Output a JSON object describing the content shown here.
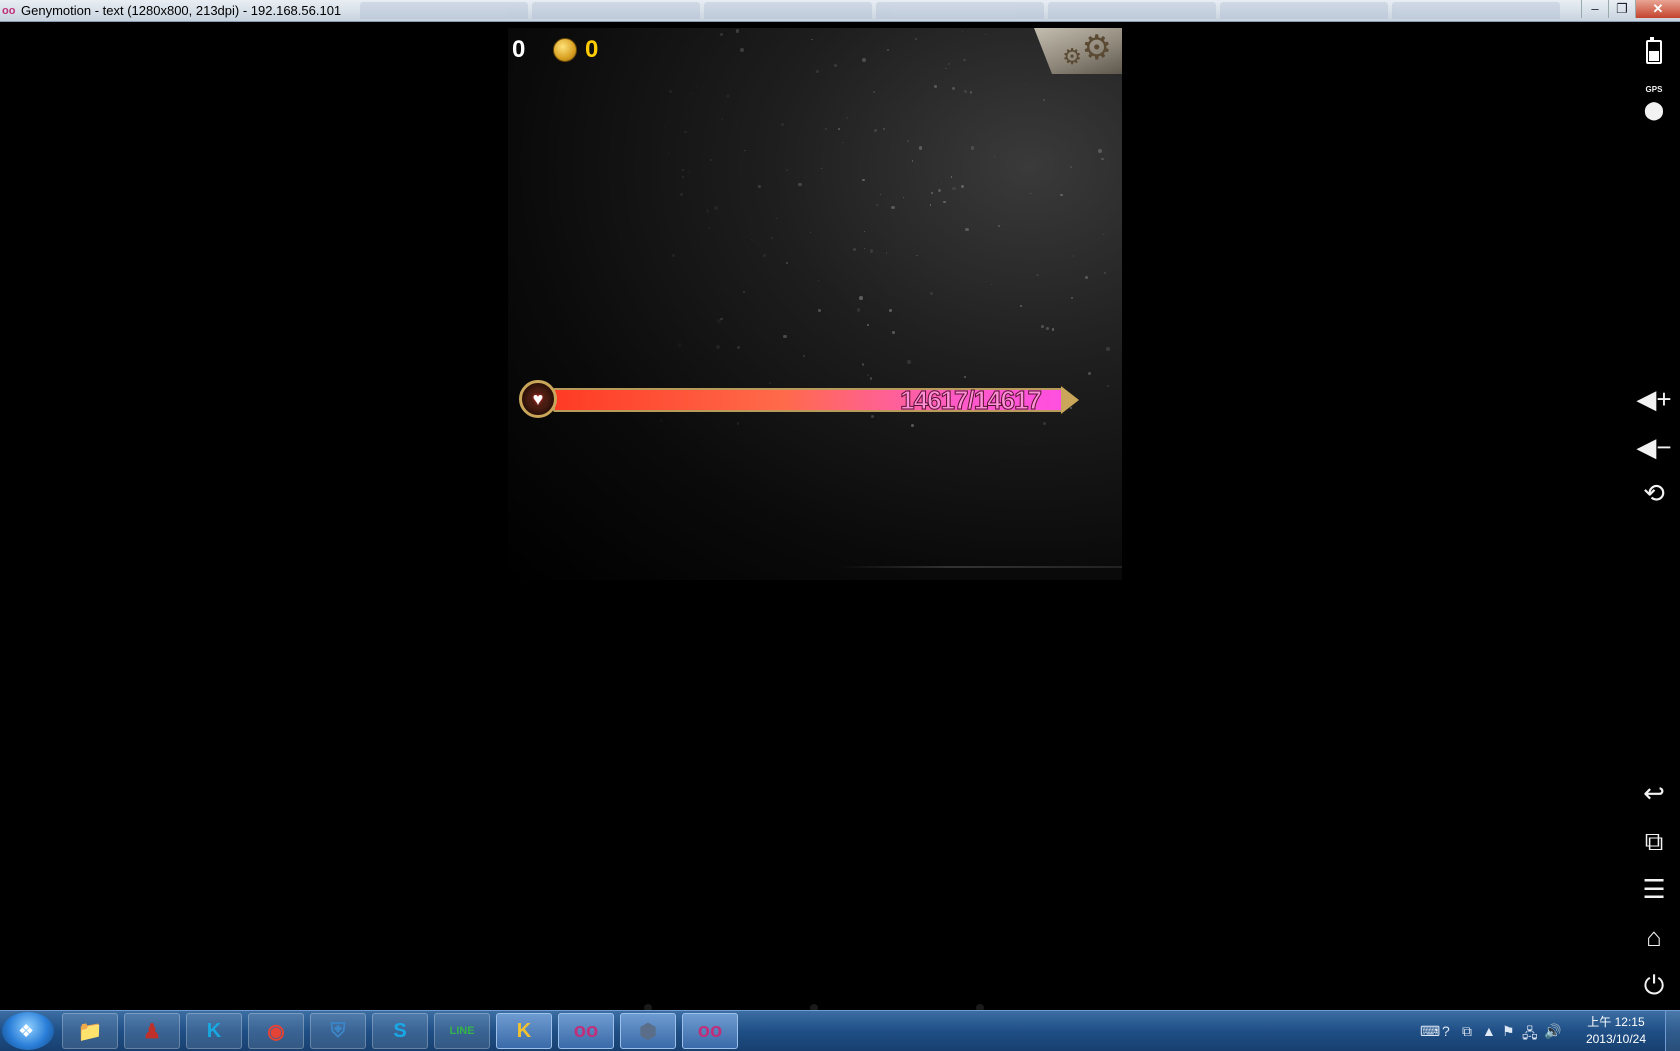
{
  "window": {
    "logo": "oo",
    "title": "Genymotion - text (1280x800, 213dpi) - 192.168.56.101",
    "controls": {
      "minimize": "–",
      "restore": "❐",
      "close": "✕"
    }
  },
  "game": {
    "chest_count": "0",
    "coin_count": "0",
    "settings_icon": "gear-icon",
    "hp": {
      "text": "14617/14617",
      "current": 14617,
      "max": 14617,
      "icon": "heart-icon"
    }
  },
  "device_sidebar": {
    "gps_label": "GPS",
    "buttons": [
      "battery-icon",
      "gps-icon",
      "volume-up",
      "volume-down",
      "rotate",
      "back",
      "recent-apps",
      "menu",
      "home",
      "power"
    ]
  },
  "taskbar": {
    "apps": [
      {
        "name": "file-explorer",
        "glyph": "📁"
      },
      {
        "name": "red-app",
        "glyph": "♟"
      },
      {
        "name": "k-app",
        "glyph": "K"
      },
      {
        "name": "chrome",
        "glyph": "◉"
      },
      {
        "name": "shield-app",
        "glyph": "⛨"
      },
      {
        "name": "skype",
        "glyph": "S"
      },
      {
        "name": "line",
        "glyph": "LINE"
      },
      {
        "name": "yellow-app",
        "glyph": "K"
      },
      {
        "name": "genymotion-1",
        "glyph": "oo"
      },
      {
        "name": "virtualbox",
        "glyph": "⬢"
      },
      {
        "name": "genymotion-2",
        "glyph": "oo"
      }
    ],
    "clock_time": "上午 12:15",
    "clock_date": "2013/10/24"
  },
  "colors": {
    "hp_fill_start": "#ff3b25",
    "hp_fill_end": "#ff4fe0",
    "hud_chest_value": "#ffffff",
    "hud_coin_value": "#ffcc00"
  }
}
